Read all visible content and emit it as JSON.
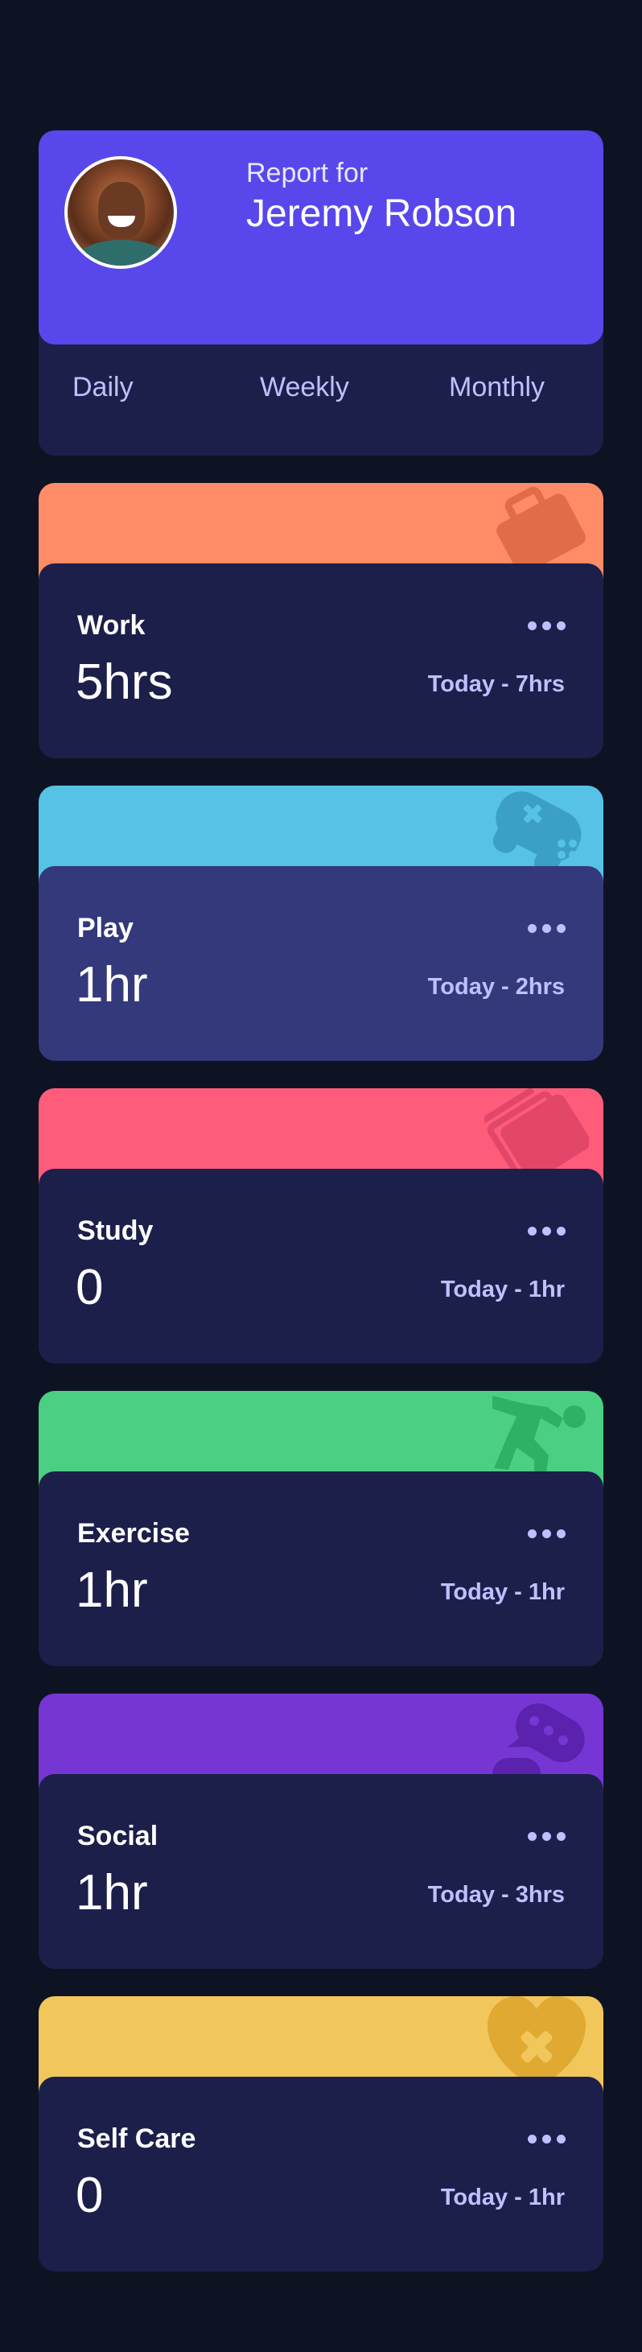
{
  "profile": {
    "report_for": "Report for",
    "name": "Jeremy Robson",
    "avatar_alt": "avatar"
  },
  "tabs": [
    {
      "label": "Daily"
    },
    {
      "label": "Weekly"
    },
    {
      "label": "Monthly"
    }
  ],
  "cards": [
    {
      "title": "Work",
      "hours": "5hrs",
      "previous": "Today - 7hrs",
      "color": "#ff8c66",
      "icon": "briefcase-icon"
    },
    {
      "title": "Play",
      "hours": "1hr",
      "previous": "Today - 2hrs",
      "color": "#56c2e6",
      "icon": "gamepad-icon"
    },
    {
      "title": "Study",
      "hours": "0",
      "previous": "Today - 1hr",
      "color": "#ff5c7c",
      "icon": "books-icon"
    },
    {
      "title": "Exercise",
      "hours": "1hr",
      "previous": "Today - 1hr",
      "color": "#4bcf83",
      "icon": "runner-icon"
    },
    {
      "title": "Social",
      "hours": "1hr",
      "previous": "Today - 3hrs",
      "color": "#7536d3",
      "icon": "chat-icon"
    },
    {
      "title": "Self Care",
      "hours": "0",
      "previous": "Today - 1hr",
      "color": "#f1c65b",
      "icon": "heart-icon"
    }
  ]
}
